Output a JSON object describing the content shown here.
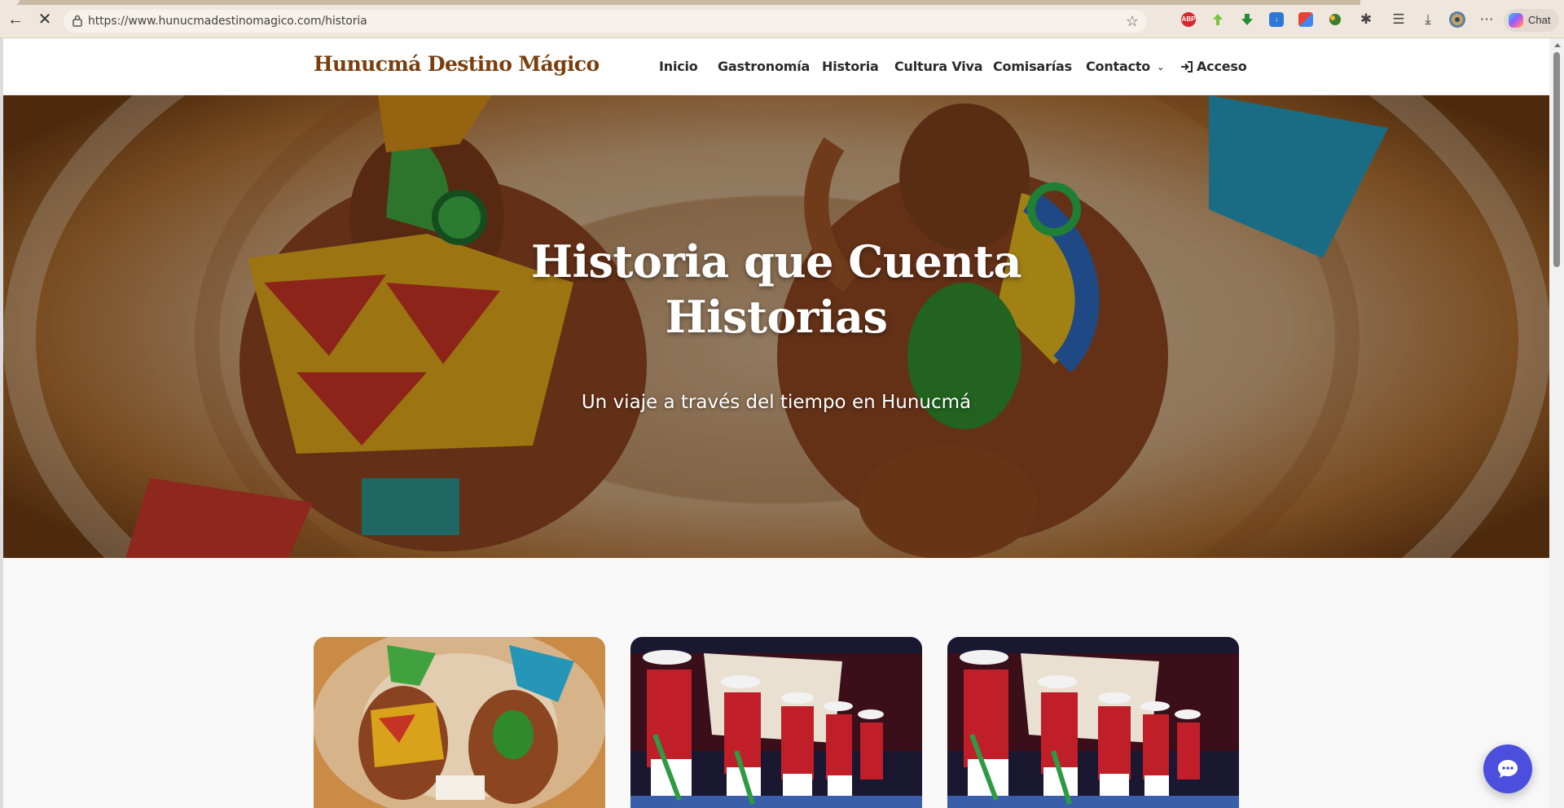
{
  "browser": {
    "url": "https://www.hunucmadestinomagico.com/historia",
    "copilot_label": "Chat",
    "extensions": [
      "ABP"
    ]
  },
  "site": {
    "brand": "Hunucmá Destino Mágico",
    "nav": [
      {
        "label": "Inicio"
      },
      {
        "label": "Gastronomía"
      },
      {
        "label": "Historia"
      },
      {
        "label": "Cultura Viva"
      },
      {
        "label": "Comisarías"
      },
      {
        "label": "Contacto"
      },
      {
        "label": "Acceso"
      }
    ]
  },
  "hero": {
    "title": "Historia que Cuenta Historias",
    "subtitle": "Un viaje a través del tiempo en Hunucmá"
  },
  "colors": {
    "brand": "#7a3f10",
    "chat_button": "#4c4ede"
  }
}
